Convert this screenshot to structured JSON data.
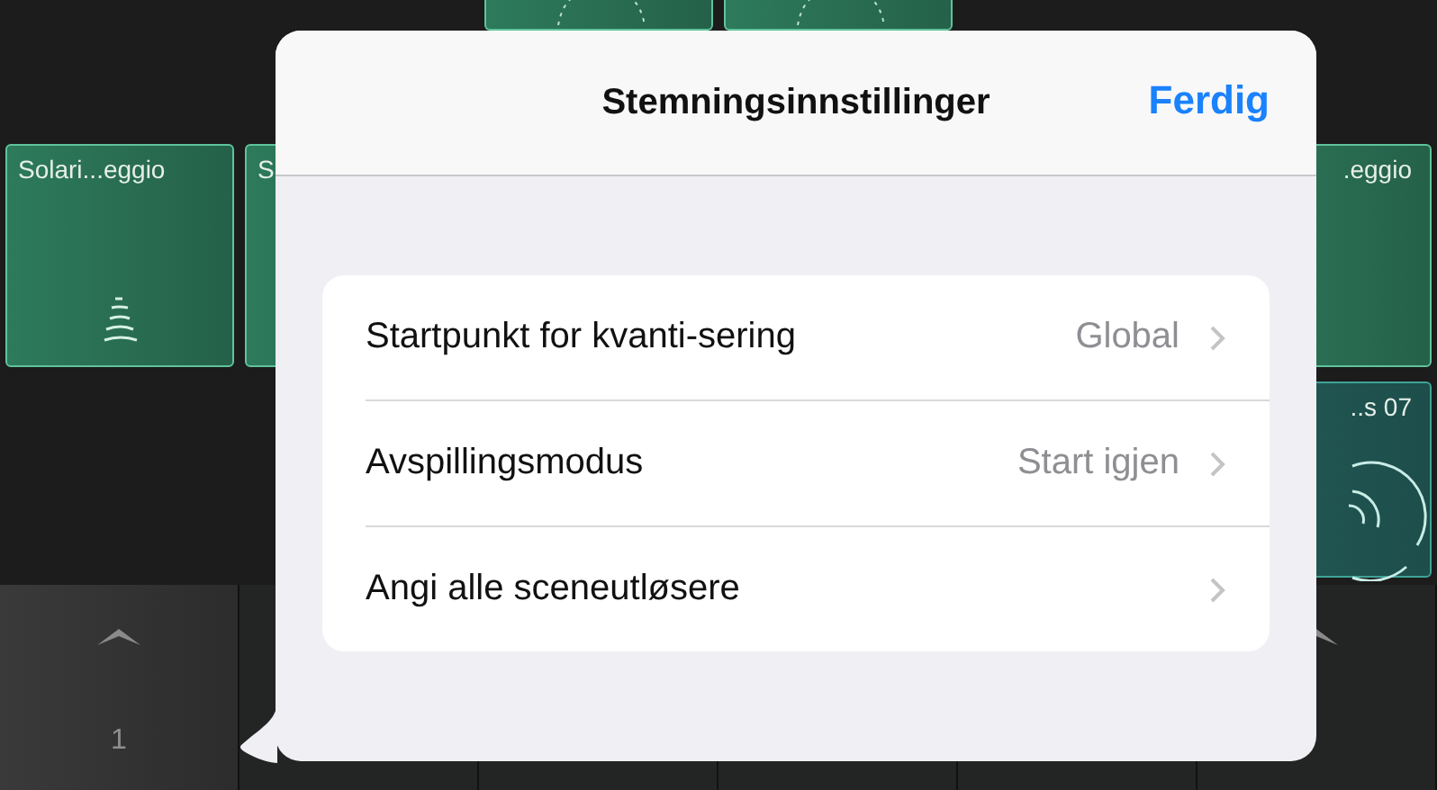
{
  "grid": [
    {
      "cells": [
        {
          "kind": "empty"
        },
        {
          "kind": "empty"
        },
        {
          "kind": "green",
          "art": {
            "kind": "dots"
          }
        },
        {
          "kind": "green",
          "art": {
            "kind": "dots"
          }
        },
        {
          "kind": "empty"
        },
        {
          "kind": "empty"
        }
      ]
    },
    {
      "cells": [
        {
          "kind": "green",
          "label": "Solari...eggio",
          "art": {
            "kind": "swirl"
          }
        },
        {
          "kind": "green",
          "label": "S"
        },
        {
          "kind": "empty"
        },
        {
          "kind": "empty"
        },
        {
          "kind": "empty"
        },
        {
          "kind": "green",
          "label": ".eggio"
        }
      ]
    },
    {
      "cells": [
        {
          "kind": "empty"
        },
        {
          "kind": "empty"
        },
        {
          "kind": "empty"
        },
        {
          "kind": "empty"
        },
        {
          "kind": "empty"
        },
        {
          "kind": "teal",
          "label": "..s 07",
          "art": {
            "kind": "rings"
          }
        }
      ]
    }
  ],
  "scene_bar": [
    {
      "label": "1",
      "selected": true,
      "icon": {
        "kind": "chevron"
      }
    },
    {
      "selected": false
    },
    {
      "selected": false
    },
    {
      "selected": false
    },
    {
      "selected": false
    },
    {
      "selected": false,
      "icon": {
        "kind": "chevron-half"
      }
    }
  ],
  "popover": {
    "title": "Stemningsinnstillinger",
    "done": "Ferdig",
    "rows": [
      {
        "label": "Startpunkt for kvanti-sering",
        "value": "Global"
      },
      {
        "label": "Avspillingsmodus",
        "value": "Start igjen"
      },
      {
        "label": "Angi alle sceneutløsere"
      }
    ]
  }
}
